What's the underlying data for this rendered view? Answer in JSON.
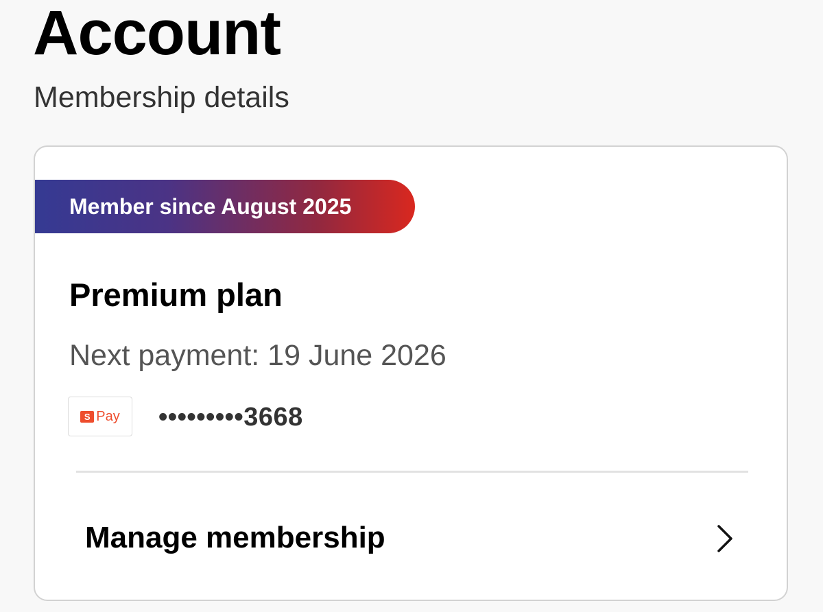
{
  "header": {
    "title": "Account",
    "subtitle": "Membership details"
  },
  "membership": {
    "badge": "Member since August 2025",
    "plan_name": "Premium plan",
    "next_payment": "Next payment: 19 June 2026",
    "payment_method": {
      "logo_text": "Pay",
      "logo_mark": "S",
      "masked_number": "•••••••••3668"
    },
    "manage_label": "Manage membership",
    "manage_icon": "chevron-right-icon"
  },
  "colors": {
    "badge_gradient_start": "#353a93",
    "badge_gradient_end": "#d9281f",
    "pay_brand": "#ee4d2d",
    "background": "#f8f8f8"
  }
}
